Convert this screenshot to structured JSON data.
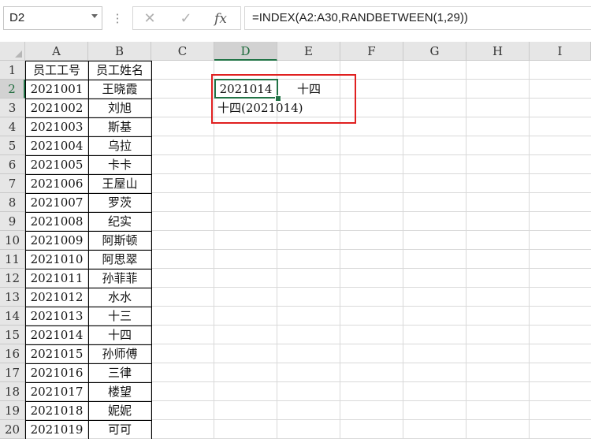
{
  "formula_bar": {
    "name_box": "D2",
    "cancel_icon": "cancel-icon",
    "enter_icon": "check-icon",
    "fx_label": "fx",
    "formula": "=INDEX(A2:A30,RANDBETWEEN(1,29))"
  },
  "columns": [
    "A",
    "B",
    "C",
    "D",
    "E",
    "F",
    "G",
    "H",
    "I"
  ],
  "rows": [
    "1",
    "2",
    "3",
    "4",
    "5",
    "6",
    "7",
    "8",
    "9",
    "10",
    "11",
    "12",
    "13",
    "14",
    "15",
    "16",
    "17",
    "18",
    "19",
    "20"
  ],
  "selected_cell": {
    "column": "D",
    "row": "2"
  },
  "table": {
    "headers": {
      "a": "员工工号",
      "b": "员工姓名"
    },
    "ids": [
      "2021001",
      "2021002",
      "2021003",
      "2021004",
      "2021005",
      "2021006",
      "2021007",
      "2021008",
      "2021009",
      "2021010",
      "2021011",
      "2021012",
      "2021013",
      "2021014",
      "2021015",
      "2021016",
      "2021017",
      "2021018",
      "2021019"
    ],
    "names": [
      "王晓霞",
      "刘旭",
      "斯基",
      "乌拉",
      "卡卡",
      "王屋山",
      "罗茨",
      "纪实",
      "阿斯顿",
      "阿思翠",
      "孙菲菲",
      "水水",
      "十三",
      "十四",
      "孙师傅",
      "三律",
      "楼望",
      "妮妮",
      "可可"
    ]
  },
  "result": {
    "d2": "2021014",
    "e2": "十四",
    "d3": "十四(2021014)"
  },
  "colors": {
    "accent": "#217346",
    "highlight_box": "#e02020"
  }
}
